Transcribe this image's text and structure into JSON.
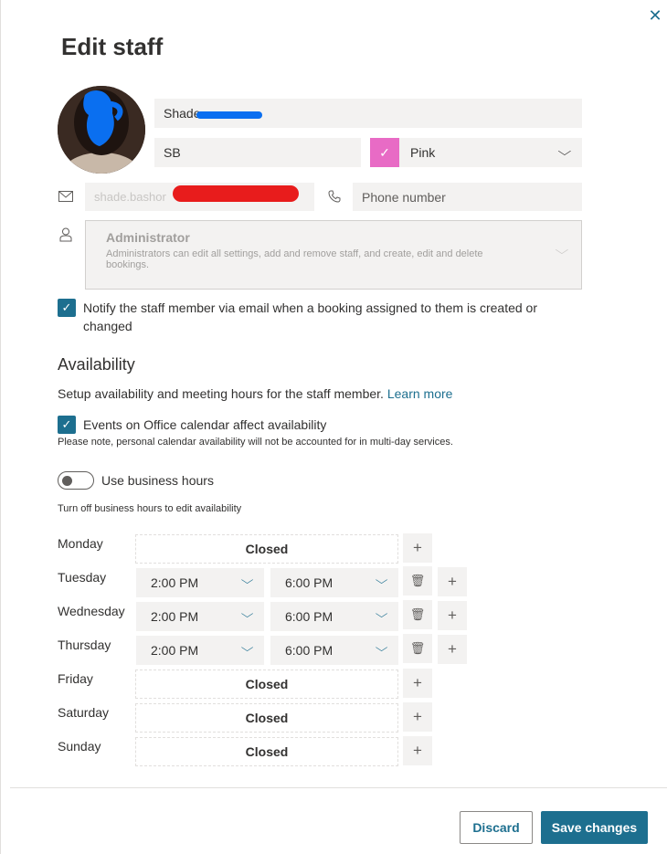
{
  "panel": {
    "title": "Edit staff",
    "close_icon": "close-icon"
  },
  "profile": {
    "name_value": "Shade",
    "initials_value": "SB",
    "color_label": "Pink",
    "color_hex": "#e86bc5",
    "email_value": "shade.bashor",
    "phone_placeholder": "Phone number"
  },
  "role": {
    "title": "Administrator",
    "description": "Administrators can edit all settings, add and remove staff, and create, edit and delete bookings."
  },
  "notify": {
    "label": "Notify the staff member via email when a booking assigned to them is created or changed",
    "checked": true
  },
  "availability": {
    "heading": "Availability",
    "description": "Setup availability and meeting hours for the staff member.",
    "learn_more": "Learn more",
    "office_calendar_label": "Events on Office calendar affect availability",
    "office_calendar_note": "Please note, personal calendar availability will not be accounted for in multi-day services.",
    "business_hours_label": "Use business hours",
    "business_hours_note": "Turn off business hours to edit availability",
    "closed_label": "Closed",
    "days": [
      {
        "name": "Monday"
      },
      {
        "name": "Tuesday",
        "start": "2:00 PM",
        "end": "6:00 PM"
      },
      {
        "name": "Wednesday",
        "start": "2:00 PM",
        "end": "6:00 PM"
      },
      {
        "name": "Thursday",
        "start": "2:00 PM",
        "end": "6:00 PM"
      },
      {
        "name": "Friday"
      },
      {
        "name": "Saturday"
      },
      {
        "name": "Sunday"
      }
    ]
  },
  "footer": {
    "discard_label": "Discard",
    "save_label": "Save changes"
  },
  "colors": {
    "accent": "#1d6f8f",
    "field_bg": "#f3f2f1"
  }
}
